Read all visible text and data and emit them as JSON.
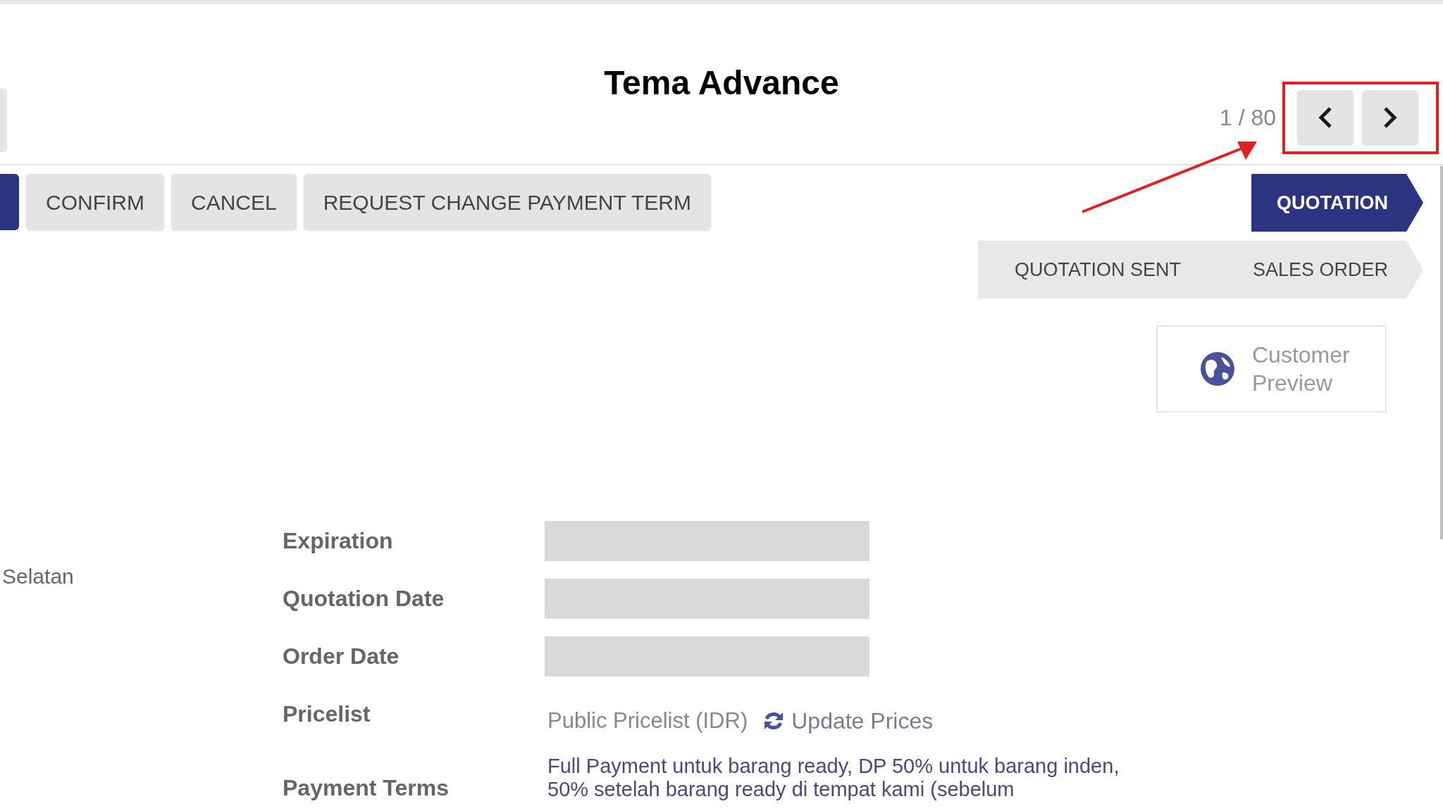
{
  "title": "Tema Advance",
  "pager": {
    "counter": "1 / 80"
  },
  "actions": [
    {
      "label": "CONFIRM"
    },
    {
      "label": "CANCEL"
    },
    {
      "label": "REQUEST CHANGE PAYMENT TERM"
    }
  ],
  "status_steps": [
    {
      "label": "QUOTATION",
      "selected": true
    },
    {
      "label": "QUOTATION SENT",
      "selected": false
    },
    {
      "label": "SALES ORDER",
      "selected": false
    }
  ],
  "smart_button": {
    "label": "Customer Preview"
  },
  "left_column": {
    "text": "Selatan"
  },
  "form": [
    {
      "label": "Expiration",
      "kind": "blank"
    },
    {
      "label": "Quotation Date",
      "kind": "blank"
    },
    {
      "label": "Order Date",
      "kind": "blank"
    },
    {
      "label": "Pricelist",
      "kind": "pricelist",
      "value": "Public Pricelist (IDR)",
      "action": "Update Prices"
    },
    {
      "label": "Payment Terms",
      "kind": "text",
      "lines": [
        "Full Payment untuk barang ready, DP 50% untuk barang inden,",
        "50% setelah barang ready di tempat kami (sebelum"
      ]
    }
  ]
}
